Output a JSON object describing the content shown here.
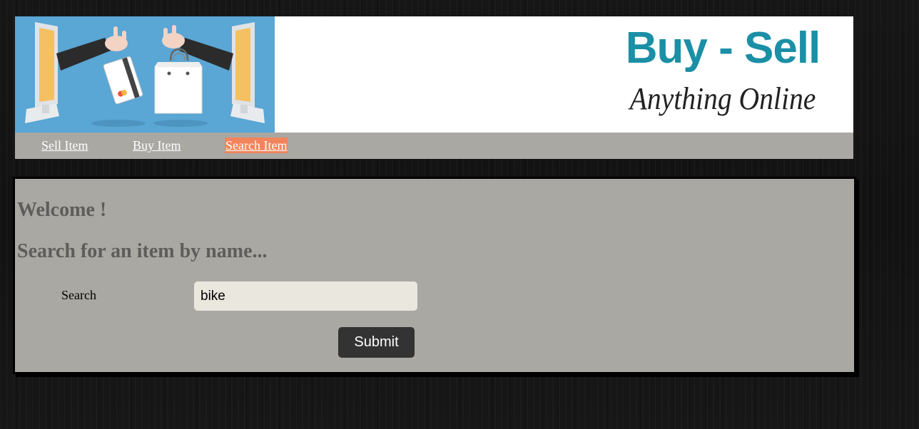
{
  "header": {
    "banner_image_alt": "hands exchanging card and shopping bag between two computer screens",
    "brand_title": "Buy - Sell",
    "brand_subtitle": "Anything Online"
  },
  "nav": {
    "items": [
      {
        "label": "Sell Item",
        "active": false
      },
      {
        "label": "Buy Item",
        "active": false
      },
      {
        "label": "Search Item",
        "active": true
      }
    ]
  },
  "main": {
    "welcome": "Welcome !",
    "heading": "Search for an item by name...",
    "search_label": "Search",
    "search_value": "bike",
    "submit_label": "Submit"
  },
  "colors": {
    "accent": "#f2845c",
    "panel_bg": "#aaa8a3",
    "brand_blue": "#1b8fa6",
    "button_bg": "#333333",
    "input_bg": "#e9e7de"
  }
}
